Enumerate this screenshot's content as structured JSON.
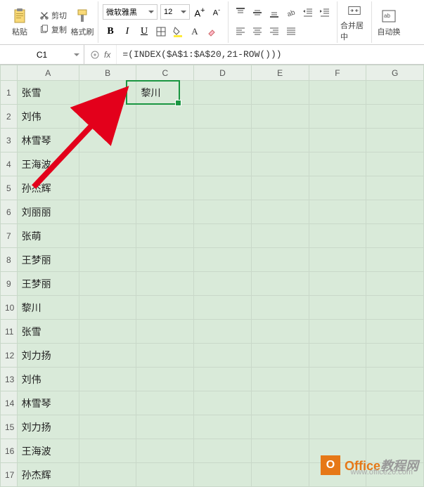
{
  "ribbon": {
    "paste_label": "粘贴",
    "cut_label": "剪切",
    "copy_label": "复制",
    "format_painter_label": "格式刷",
    "font_name": "微软雅黑",
    "font_size": "12",
    "bold": "B",
    "italic": "I",
    "underline": "U",
    "merge_label": "合并居中",
    "autowrap_label": "自动换"
  },
  "namebox": "C1",
  "fx_label": "fx",
  "formula": "=(INDEX($A$1:$A$20,21-ROW()))",
  "columns": [
    "A",
    "B",
    "C",
    "D",
    "E",
    "F",
    "G"
  ],
  "rows": [
    {
      "n": "1",
      "a": "张雪",
      "c": "黎川"
    },
    {
      "n": "2",
      "a": "刘伟",
      "c": ""
    },
    {
      "n": "3",
      "a": "林雪琴",
      "c": ""
    },
    {
      "n": "4",
      "a": "王海波",
      "c": ""
    },
    {
      "n": "5",
      "a": "孙杰辉",
      "c": ""
    },
    {
      "n": "6",
      "a": "刘丽丽",
      "c": ""
    },
    {
      "n": "7",
      "a": "张萌",
      "c": ""
    },
    {
      "n": "8",
      "a": "王梦丽",
      "c": ""
    },
    {
      "n": "9",
      "a": "王梦丽",
      "c": ""
    },
    {
      "n": "10",
      "a": "黎川",
      "c": ""
    },
    {
      "n": "11",
      "a": "张雪",
      "c": ""
    },
    {
      "n": "12",
      "a": "刘力扬",
      "c": ""
    },
    {
      "n": "13",
      "a": "刘伟",
      "c": ""
    },
    {
      "n": "14",
      "a": "林雪琴",
      "c": ""
    },
    {
      "n": "15",
      "a": "刘力扬",
      "c": ""
    },
    {
      "n": "16",
      "a": "王海波",
      "c": ""
    },
    {
      "n": "17",
      "a": "孙杰辉",
      "c": ""
    }
  ],
  "watermark": {
    "brand1": "Office",
    "brand2": "教程网",
    "url": "www.office26.com"
  },
  "chart_data": {
    "type": "table",
    "title": "",
    "columns": [
      "A",
      "B",
      "C",
      "D",
      "E",
      "F",
      "G"
    ],
    "data_column_A": [
      "张雪",
      "刘伟",
      "林雪琴",
      "王海波",
      "孙杰辉",
      "刘丽丽",
      "张萌",
      "王梦丽",
      "王梦丽",
      "黎川",
      "张雪",
      "刘力扬",
      "刘伟",
      "林雪琴",
      "刘力扬",
      "王海波",
      "孙杰辉"
    ],
    "active_cell": "C1",
    "active_cell_value": "黎川",
    "active_cell_formula": "=(INDEX($A$1:$A$20,21-ROW()))"
  }
}
